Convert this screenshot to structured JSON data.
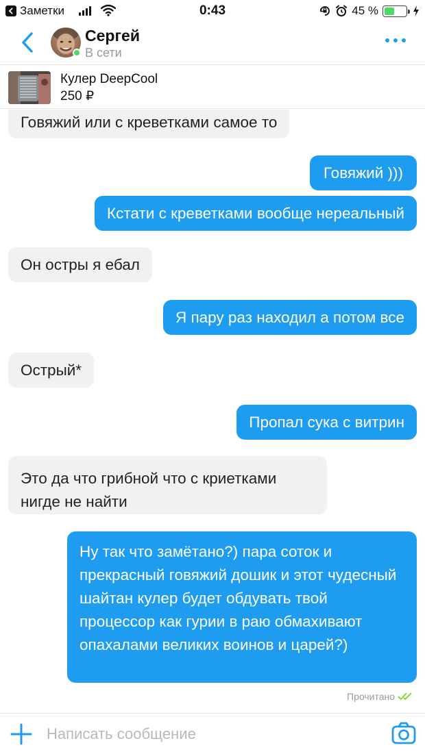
{
  "status_bar": {
    "back_app": "Заметки",
    "time": "0:43",
    "battery_percent": "45 %",
    "battery_level": 0.45
  },
  "header": {
    "contact_name": "Сергей",
    "contact_status": "В сети"
  },
  "product": {
    "title": "Кулер DeepCool",
    "price": "250 ₽"
  },
  "messages": [
    {
      "side": "in",
      "text": "Говяжий или с креветками самое то"
    },
    {
      "side": "out",
      "text": "Говяжий )))"
    },
    {
      "side": "out",
      "text": "Кстати с креветками вообще нереальный"
    },
    {
      "side": "in",
      "text": "Он остры я ебал"
    },
    {
      "side": "out",
      "text": "Я пару раз находил а потом все"
    },
    {
      "side": "in",
      "text": "Острый*"
    },
    {
      "side": "out",
      "text": "Пропал сука с витрин"
    },
    {
      "side": "in",
      "text": "Это да что грибной что с криетками нигде не найти"
    },
    {
      "side": "out",
      "text": "Ну так что замётано?) пара соток и прекрасный говяжий дошик и этот чудесный шайтан кулер будет обдувать твой процессор как гурии в раю обмахивают опахалами великих воинов и царей?)"
    }
  ],
  "read_status": "Прочитано",
  "composer": {
    "placeholder": "Написать сообщение"
  },
  "colors": {
    "accent": "#1e9cf0",
    "incoming_bubble": "#f1f1f1",
    "online": "#4cd964"
  },
  "icons": [
    "back-chevron-icon",
    "more-dots-icon",
    "add-plus-icon",
    "camera-icon",
    "double-check-icon",
    "wifi-icon",
    "signal-icon",
    "alarm-icon",
    "lock-rotation-icon",
    "charging-bolt-icon"
  ]
}
